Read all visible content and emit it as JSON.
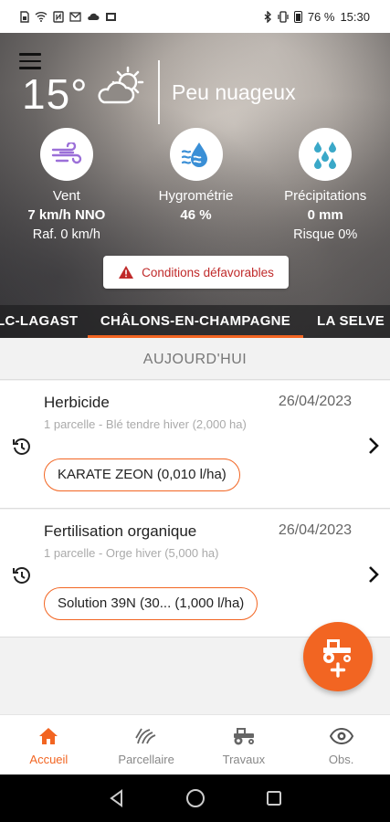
{
  "status_bar": {
    "battery": "76 %",
    "time": "15:30",
    "left_icons": [
      "sim-icon",
      "wifi-icon",
      "nfc-icon",
      "mail-icon",
      "cloud-icon",
      "sync-icon"
    ],
    "right_icons": [
      "bluetooth-icon",
      "vibrate-icon",
      "battery-icon"
    ]
  },
  "weather": {
    "temperature": "15°",
    "condition": "Peu nuageux",
    "metrics": [
      {
        "icon": "wind-icon",
        "label": "Vent",
        "value": "7 km/h NNO",
        "sub": "Raf. 0 km/h"
      },
      {
        "icon": "humidity-icon",
        "label": "Hygrométrie",
        "value": "46 %",
        "sub": ""
      },
      {
        "icon": "precipitation-icon",
        "label": "Précipitations",
        "value": "0 mm",
        "sub": "Risque 0%"
      }
    ],
    "alert_label": "Conditions défavorables"
  },
  "locations": {
    "tabs": [
      "LC-LAGAST",
      "CHÂLONS-EN-CHAMPAGNE",
      "LA SELVE"
    ],
    "selected": "CHÂLONS-EN-CHAMPAGNE"
  },
  "day_header": "AUJOURD'HUI",
  "interventions": [
    {
      "title": "Herbicide",
      "date": "26/04/2023",
      "subtitle": "1 parcelle - Blé tendre hiver (2,000 ha)",
      "product": "KARATE ZEON (0,010 l/ha)"
    },
    {
      "title": "Fertilisation organique",
      "date": "26/04/2023",
      "subtitle": "1 parcelle - Orge hiver (5,000 ha)",
      "product": "Solution 39N (30... (1,000 l/ha)"
    }
  ],
  "bottom_nav": [
    {
      "label": "Accueil",
      "icon": "home-icon",
      "active": true
    },
    {
      "label": "Parcellaire",
      "icon": "field-icon",
      "active": false
    },
    {
      "label": "Travaux",
      "icon": "tractor-icon",
      "active": false
    },
    {
      "label": "Obs.",
      "icon": "eye-icon",
      "active": false
    }
  ],
  "colors": {
    "accent": "#f26522",
    "alert_text": "#c02a2a",
    "metric_icon_blue": "#3a8fd6"
  }
}
